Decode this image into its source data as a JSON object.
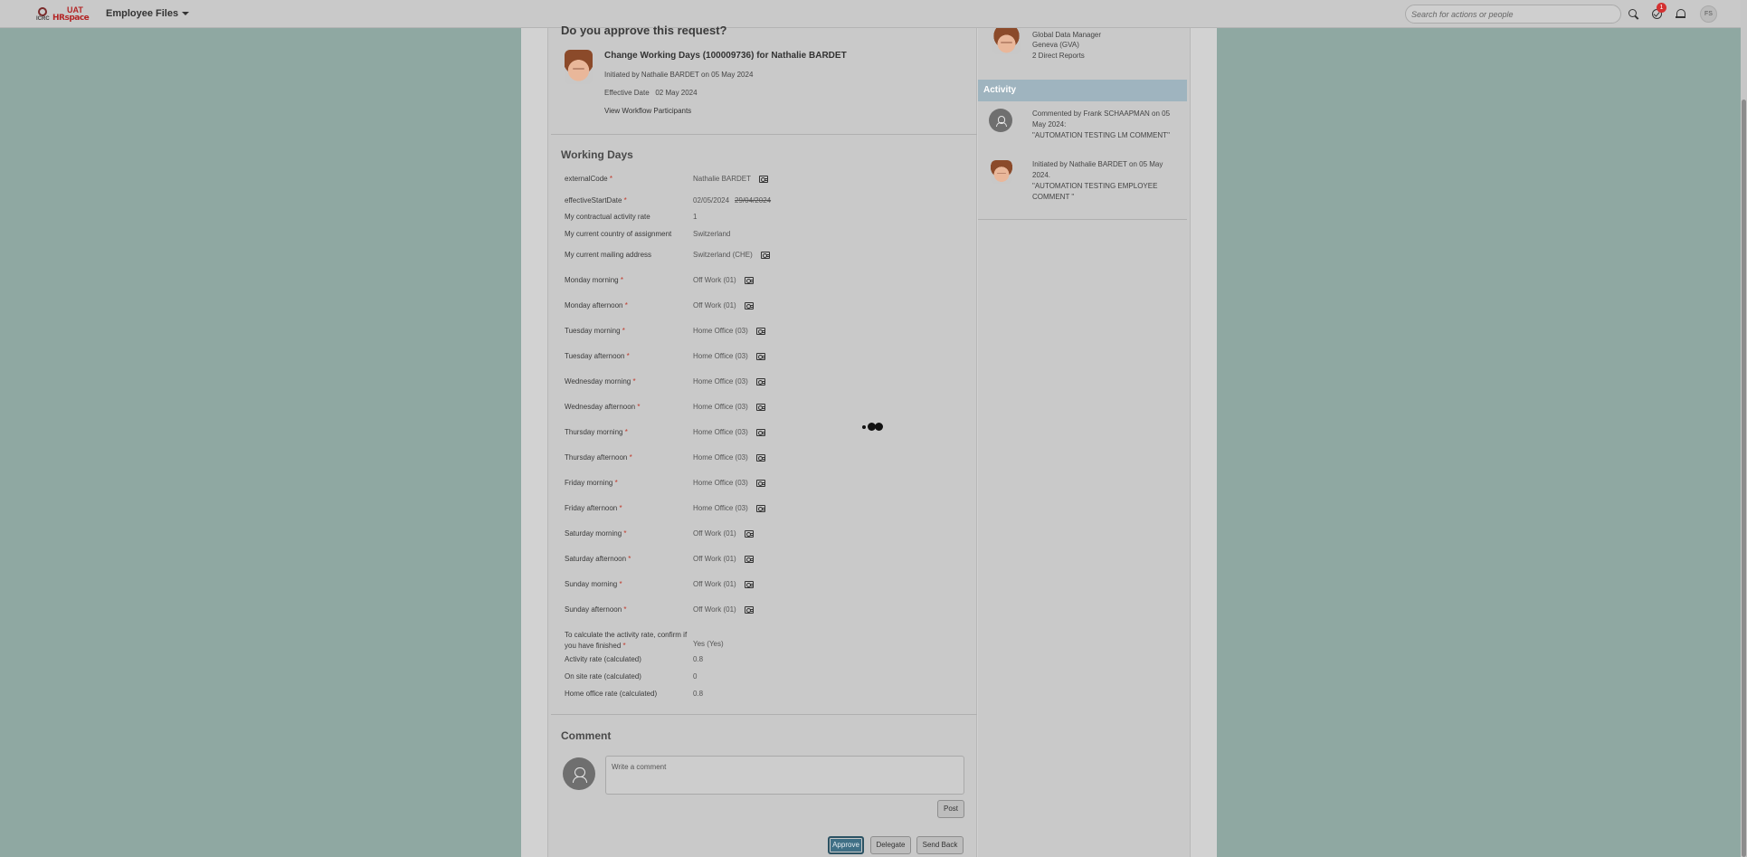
{
  "shell": {
    "logo_org": "ICRC",
    "logo_app": "HRspace",
    "logo_env": "UAT",
    "module": "Employee Files",
    "search_placeholder": "Search for actions or people",
    "todo_count": "1",
    "user_initials": "FS"
  },
  "request": {
    "question": "Do you approve this request?",
    "title": "Change Working Days (100009736) for Nathalie BARDET",
    "initiated": "Initiated by Nathalie BARDET on 05 May 2024",
    "effective_label": "Effective Date",
    "effective_date": "02 May 2024",
    "workflow_link": "View Workflow Participants"
  },
  "working_days": {
    "title": "Working Days",
    "fields": [
      {
        "label": "externalCode",
        "required": true,
        "value": "Nathalie BARDET",
        "history": true
      },
      {
        "label": "effectiveStartDate",
        "required": true,
        "value": "02/05/2024",
        "old_value": "29/04/2024",
        "history": false
      },
      {
        "label": "My contractual activity rate",
        "required": false,
        "value": "1",
        "history": false
      },
      {
        "label": "My current country of assignment",
        "required": false,
        "value": "Switzerland",
        "history": false
      },
      {
        "label": "My current mailing address",
        "required": false,
        "value": "Switzerland (CHE)",
        "history": true
      },
      {
        "label": "Monday morning",
        "required": true,
        "value": "Off Work (01)",
        "history": true
      },
      {
        "label": "Monday afternoon",
        "required": true,
        "value": "Off Work (01)",
        "history": true
      },
      {
        "label": "Tuesday morning",
        "required": true,
        "value": "Home Office (03)",
        "history": true
      },
      {
        "label": "Tuesday afternoon",
        "required": true,
        "value": "Home Office (03)",
        "history": true
      },
      {
        "label": "Wednesday morning",
        "required": true,
        "value": "Home Office (03)",
        "history": true
      },
      {
        "label": "Wednesday afternoon",
        "required": true,
        "value": "Home Office (03)",
        "history": true
      },
      {
        "label": "Thursday morning",
        "required": true,
        "value": "Home Office (03)",
        "history": true
      },
      {
        "label": "Thursday afternoon",
        "required": true,
        "value": "Home Office (03)",
        "history": true
      },
      {
        "label": "Friday morning",
        "required": true,
        "value": "Home Office (03)",
        "history": true
      },
      {
        "label": "Friday afternoon",
        "required": true,
        "value": "Home Office (03)",
        "history": true
      },
      {
        "label": "Saturday morning",
        "required": true,
        "value": "Off Work (01)",
        "history": true
      },
      {
        "label": "Saturday afternoon",
        "required": true,
        "value": "Off Work (01)",
        "history": true
      },
      {
        "label": "Sunday morning",
        "required": true,
        "value": "Off Work (01)",
        "history": true
      },
      {
        "label": "Sunday afternoon",
        "required": true,
        "value": "Off Work (01)",
        "history": true
      },
      {
        "label": "To calculate the activity rate, confirm if you have finished",
        "required": true,
        "value": "Yes (Yes)",
        "history": false
      },
      {
        "label": "Activity rate (calculated)",
        "required": false,
        "value": "0.8",
        "history": false
      },
      {
        "label": "On site rate (calculated)",
        "required": false,
        "value": "0",
        "history": false
      },
      {
        "label": "Home office rate (calculated)",
        "required": false,
        "value": "0.8",
        "history": false
      }
    ]
  },
  "comment": {
    "title": "Comment",
    "placeholder": "Write a comment",
    "post": "Post"
  },
  "actions": {
    "approve": "Approve",
    "delegate": "Delegate",
    "send_back": "Send Back"
  },
  "side": {
    "role": "Global Data Manager",
    "location": "Geneva (GVA)",
    "reports": "2 Direct Reports",
    "activity_title": "Activity",
    "activity": [
      {
        "text": "Commented by Frank SCHAAPMAN on 05 May 2024:",
        "quote": "\"AUTOMATION TESTING LM COMMENT\""
      },
      {
        "text": "Initiated by Nathalie BARDET on 05 May 2024.",
        "quote": "\"AUTOMATION TESTING EMPLOYEE COMMENT \""
      }
    ]
  },
  "colors": {
    "backdrop": "#8fa8a2",
    "primary_button": "#3f6f85",
    "activity_header": "#9fb4bf",
    "required_marker": "#c0392b",
    "badge": "#d43131"
  }
}
